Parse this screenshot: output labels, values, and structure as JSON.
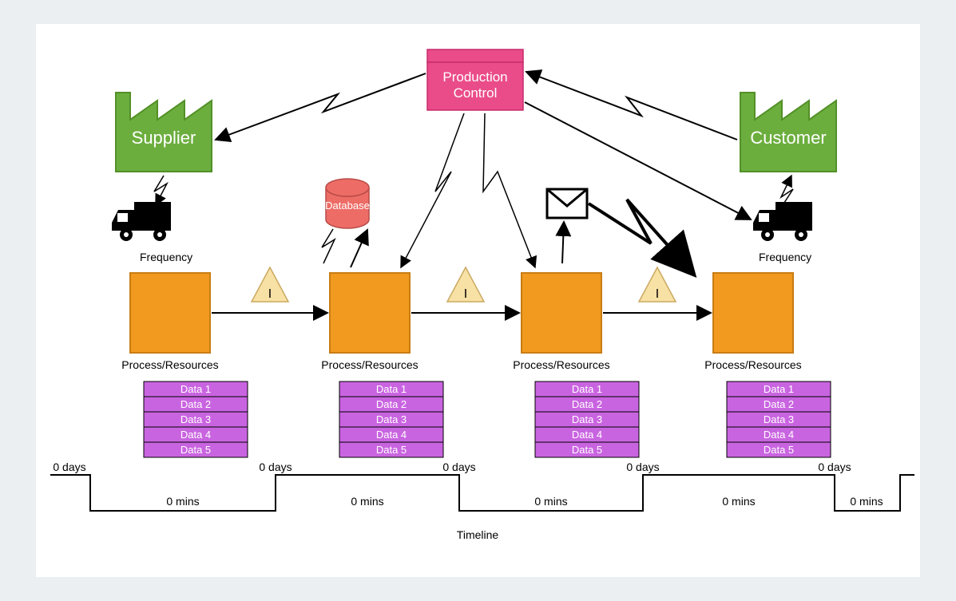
{
  "productionControl": "Production Control",
  "supplier": "Supplier",
  "customer": "Customer",
  "database": "Database",
  "frequency": "Frequency",
  "processLabel": "Process/Resources",
  "inventory": "I",
  "dataRows": [
    "Data 1",
    "Data 2",
    "Data 3",
    "Data 4",
    "Data 5"
  ],
  "tlDays": "0 days",
  "tlMins": "0 mins",
  "timeline": "Timeline",
  "colors": {
    "green": "#6cae3e",
    "pink": "#ea4c89",
    "pinkDark": "#d13a76",
    "orange": "#f19a1f",
    "purple": "#c964e0",
    "cream": "#f8e1a4",
    "red": "#ed6c66"
  }
}
